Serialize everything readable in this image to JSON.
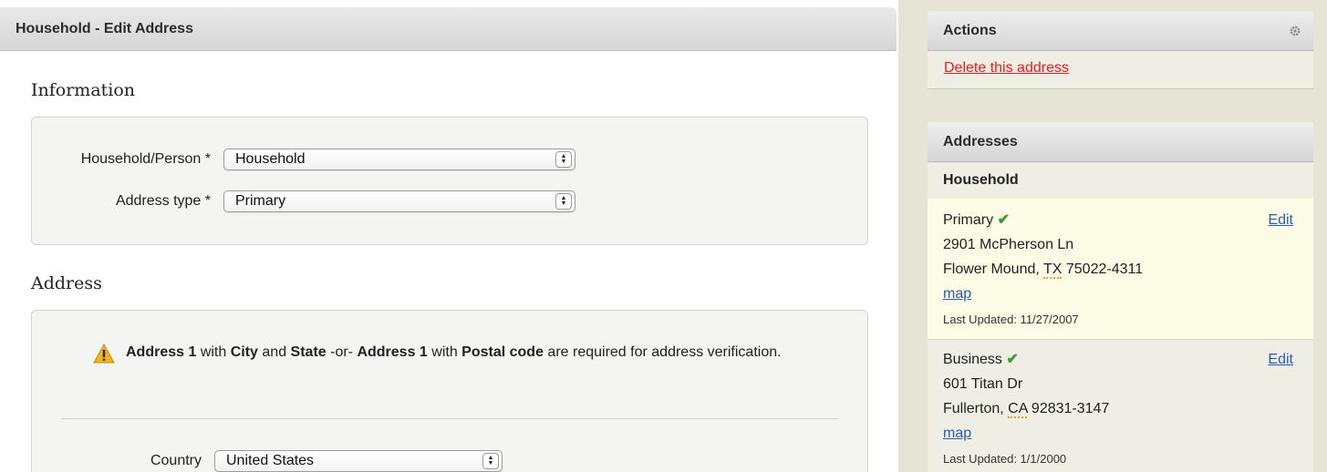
{
  "main": {
    "title": "Household - Edit Address",
    "information": {
      "section_title": "Information",
      "household_person_label": "Household/Person *",
      "household_person_value": "Household",
      "address_type_label": "Address type *",
      "address_type_value": "Primary"
    },
    "address": {
      "section_title": "Address",
      "warning": {
        "part1_bold": "Address 1",
        "part2": " with ",
        "part3_bold": "City",
        "part4": " and ",
        "part5_bold": "State",
        "part6": " -or- ",
        "part7_bold": "Address 1",
        "part8": " with ",
        "part9_bold": "Postal code",
        "part10": " are required for address verification."
      },
      "country_label": "Country",
      "country_value": "United States"
    }
  },
  "sidebar": {
    "actions": {
      "title": "Actions",
      "delete_label": "Delete this address"
    },
    "addresses": {
      "title": "Addresses",
      "group_title": "Household",
      "items": [
        {
          "type": "Primary",
          "check": "✔",
          "edit": "Edit",
          "line1": "2901 McPherson Ln",
          "city": "Flower Mound, ",
          "state": "TX",
          "zip": " 75022-4311",
          "map": "map",
          "updated": "Last Updated: 11/27/2007"
        },
        {
          "type": "Business",
          "check": "✔",
          "edit": "Edit",
          "line1": "601 Titan Dr",
          "city": "Fullerton, ",
          "state": "CA",
          "zip": " 92831-3147",
          "map": "map",
          "updated": "Last Updated: 1/1/2000"
        }
      ]
    }
  }
}
